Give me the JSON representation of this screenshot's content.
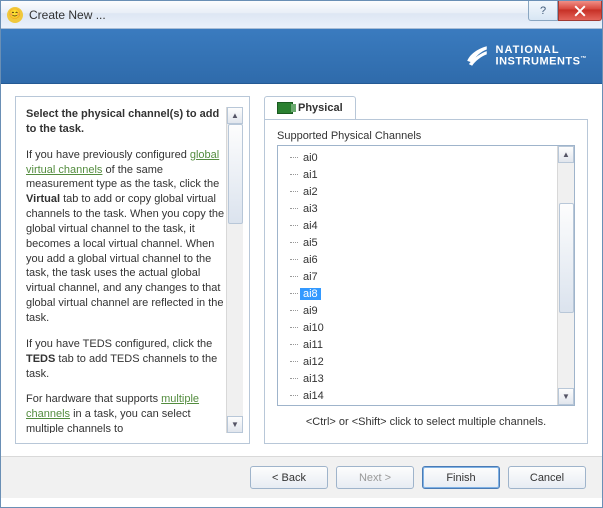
{
  "window": {
    "title": "Create New ..."
  },
  "brand": {
    "line1": "NATIONAL",
    "line2": "INSTRUMENTS",
    "tm": "™"
  },
  "help": {
    "heading": "Select the physical channel(s) to add to the task.",
    "p1_a": "If you have previously configured ",
    "p1_link": "global virtual channels",
    "p1_b": " of the same measurement type as the task, click the ",
    "p1_bold": "Virtual",
    "p1_c": " tab to add or copy global virtual channels to the task. When you copy the global virtual channel to the task, it becomes a local virtual channel. When you add a global virtual channel to the task, the task uses the actual global virtual channel, and any changes to that global virtual channel are reflected in the task.",
    "p2_a": "If you have TEDS configured, click the ",
    "p2_bold": "TEDS",
    "p2_b": " tab to add TEDS channels to the task.",
    "p3_a": "For hardware that supports ",
    "p3_link": "multiple channels",
    "p3_b": " in a task, you can select multiple channels to"
  },
  "tabs": {
    "physical": "Physical"
  },
  "channels": {
    "label": "Supported Physical Channels",
    "hint": "<Ctrl> or <Shift> click to select multiple channels.",
    "items": [
      "ai0",
      "ai1",
      "ai2",
      "ai3",
      "ai4",
      "ai5",
      "ai6",
      "ai7",
      "ai8",
      "ai9",
      "ai10",
      "ai11",
      "ai12",
      "ai13",
      "ai14"
    ],
    "selected_index": 8
  },
  "buttons": {
    "back": "< Back",
    "next": "Next >",
    "finish": "Finish",
    "cancel": "Cancel"
  }
}
